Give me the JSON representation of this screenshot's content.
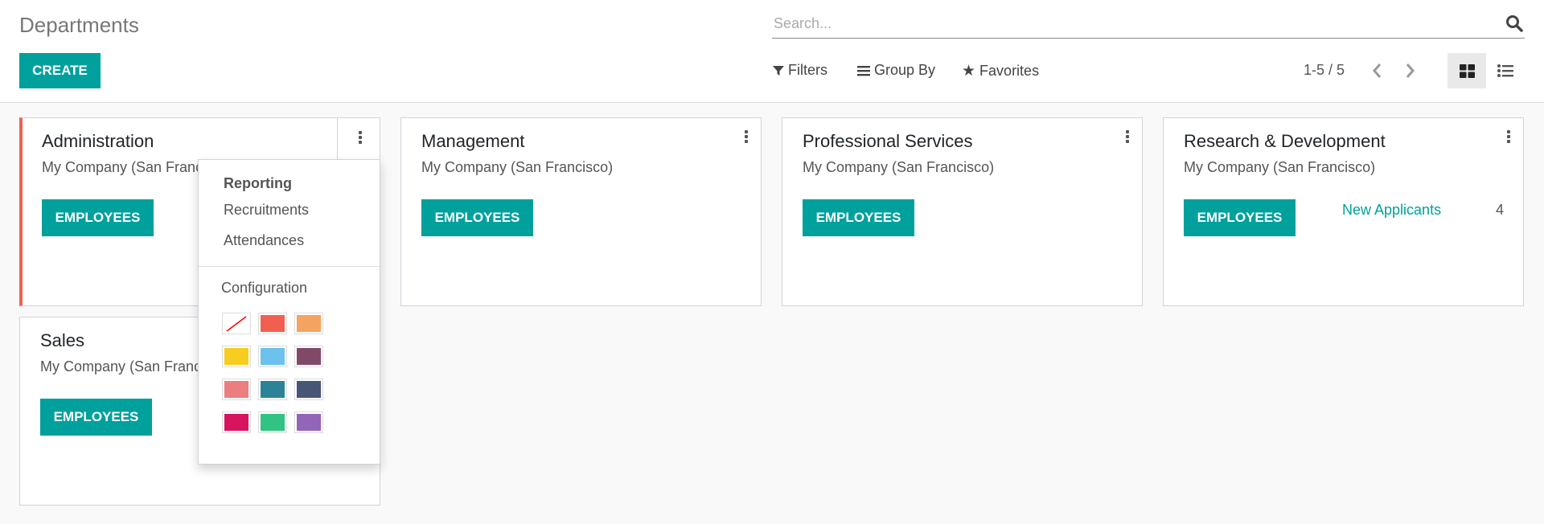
{
  "header": {
    "title": "Departments",
    "create_label": "CREATE",
    "search_placeholder": "Search...",
    "filters": "Filters",
    "group_by": "Group By",
    "favorites": "Favorites",
    "pager": "1-5 / 5",
    "views": [
      "kanban",
      "list"
    ]
  },
  "cards": [
    {
      "name": "Administration",
      "company": "My Company (San Francisco)",
      "button": "EMPLOYEES",
      "color": "#f06050"
    },
    {
      "name": "Management",
      "company": "My Company (San Francisco)",
      "button": "EMPLOYEES"
    },
    {
      "name": "Professional Services",
      "company": "My Company (San Francisco)",
      "button": "EMPLOYEES"
    },
    {
      "name": "Research & Development",
      "company": "My Company (San Francisco)",
      "button": "EMPLOYEES",
      "link": "New Applicants",
      "count": "4"
    },
    {
      "name": "Sales",
      "company": "My Company (San Francisco)",
      "button": "EMPLOYEES"
    }
  ],
  "dropdown": {
    "section": "Reporting",
    "items": [
      "Recruitments",
      "Attendances"
    ],
    "configuration": "Configuration",
    "colors": [
      "none",
      "#f06050",
      "#f4a460",
      "#f7cd1f",
      "#6cc1ed",
      "#814968",
      "#eb7e7f",
      "#2c8397",
      "#475577",
      "#d6145f",
      "#30c381",
      "#9365b8"
    ]
  },
  "accent": "#00a09d"
}
